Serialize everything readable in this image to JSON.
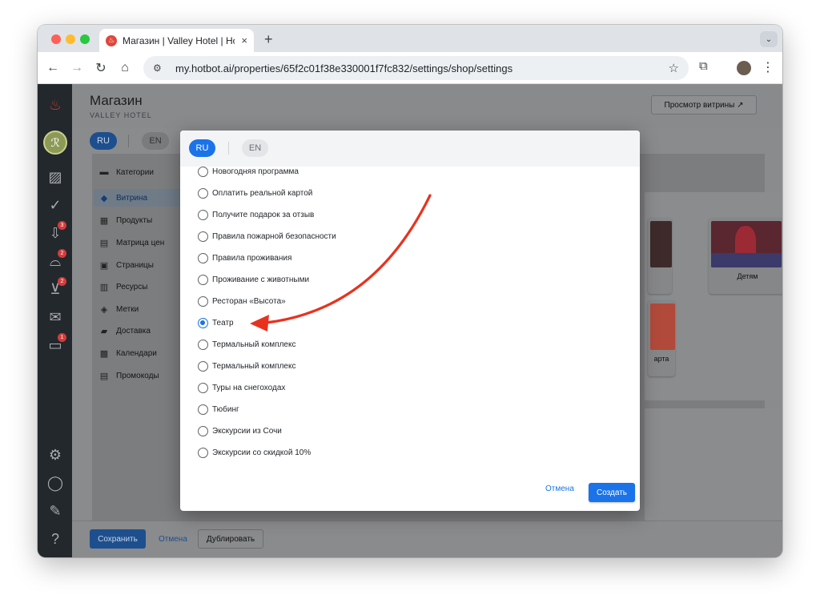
{
  "browser": {
    "tab_title": "Магазин | Valley Hotel | Hotbot",
    "url": "my.hotbot.ai/properties/65f2c01f38e330001f7fc832/settings/shop/settings",
    "new_tab_label": "+",
    "tab_close": "×"
  },
  "rail": {
    "badges": [
      "3",
      "2",
      "2",
      "1"
    ]
  },
  "header": {
    "title": "Магазин",
    "subtitle": "VALLEY HOTEL",
    "preview_button": "Просмотр витрины ↗"
  },
  "languages": {
    "active": "RU",
    "inactive": "EN"
  },
  "sidebar": {
    "items": [
      {
        "label": "Категории",
        "icon": "categories-icon"
      },
      {
        "label": "Витрина",
        "icon": "showcase-icon"
      },
      {
        "label": "Продукты",
        "icon": "products-icon"
      },
      {
        "label": "Матрица цен",
        "icon": "price-matrix-icon"
      },
      {
        "label": "Страницы",
        "icon": "pages-icon"
      },
      {
        "label": "Ресурсы",
        "icon": "resources-icon"
      },
      {
        "label": "Метки",
        "icon": "tags-icon"
      },
      {
        "label": "Доставка",
        "icon": "delivery-icon"
      },
      {
        "label": "Календари",
        "icon": "calendar-icon"
      },
      {
        "label": "Промокоды",
        "icon": "promo-icon"
      }
    ],
    "active_index": 1
  },
  "showcase": {
    "card_kids_label": "Детям",
    "card_partial_label": "арта"
  },
  "footer": {
    "save": "Сохранить",
    "cancel": "Отмена",
    "duplicate": "Дублировать"
  },
  "modal": {
    "lang_active": "RU",
    "lang_inactive": "EN",
    "options": [
      "Новогодняя программа",
      "Оплатить реальной картой",
      "Получите подарок за отзыв",
      "Правила пожарной безопасности",
      "Правила проживания",
      "Проживание с животными",
      "Ресторан «Высота»",
      "Театр",
      "Термальный комплекс",
      "Термальный комплекс",
      "Туры на снегоходах",
      "Тюбинг",
      "Экскурсии из Сочи",
      "Экскурсии со скидкой 10%"
    ],
    "selected_index": 7,
    "cancel": "Отмена",
    "create": "Создать"
  },
  "colors": {
    "accent": "#1a73e8",
    "annotation_arrow": "#e8321e",
    "rail": "#23282d"
  }
}
